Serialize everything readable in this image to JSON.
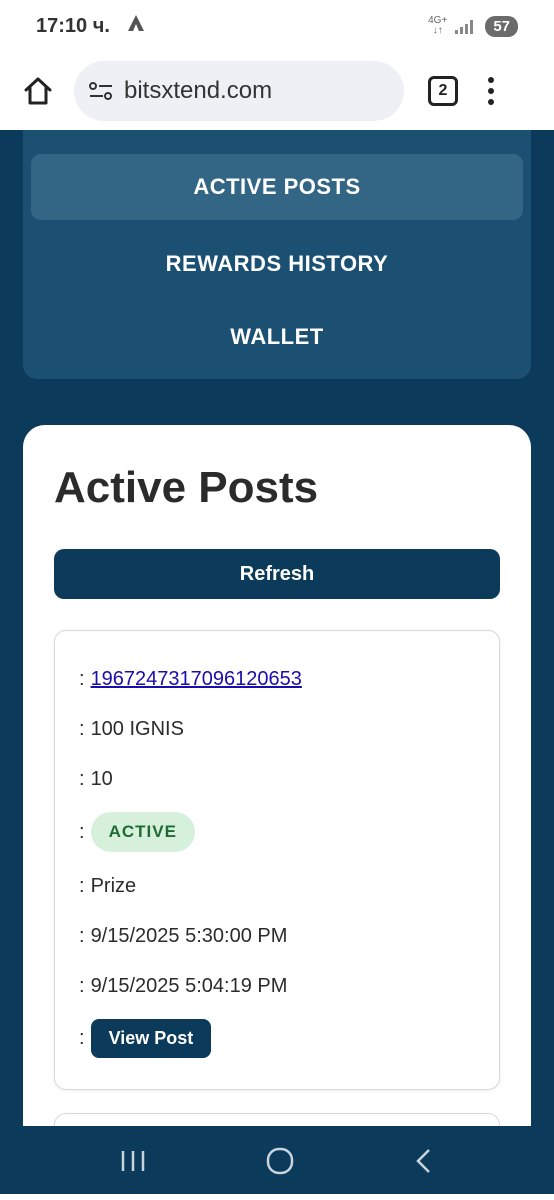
{
  "status_bar": {
    "time": "17:10 ч.",
    "network": "4G+",
    "battery": "57"
  },
  "browser": {
    "url": "bitsxtend.com",
    "tab_count": "2"
  },
  "nav": {
    "items": [
      {
        "label": "ACTIVE POSTS",
        "active": true
      },
      {
        "label": "REWARDS HISTORY",
        "active": false
      },
      {
        "label": "WALLET",
        "active": false
      }
    ]
  },
  "main": {
    "title": "Active Posts",
    "refresh_label": "Refresh",
    "post": {
      "separator": ":",
      "post_id": "1967247317096120653",
      "reward": "100 IGNIS",
      "count": "10",
      "status": "ACTIVE",
      "type": "Prize",
      "end_time": "9/15/2025 5:30:00 PM",
      "created_time": "9/15/2025 5:04:19 PM",
      "view_label": "View Post"
    }
  },
  "colors": {
    "primary": "#0b3a5a",
    "nav_panel": "#1c5072",
    "status_active_bg": "#d6f0dc",
    "status_active_text": "#1f6b32"
  },
  "icons": {
    "home": "home-icon",
    "site_settings": "tune-icon",
    "menu": "more-vert-icon",
    "system_recents": "recents-icon",
    "system_home": "circle-home-icon",
    "system_back": "back-icon"
  }
}
